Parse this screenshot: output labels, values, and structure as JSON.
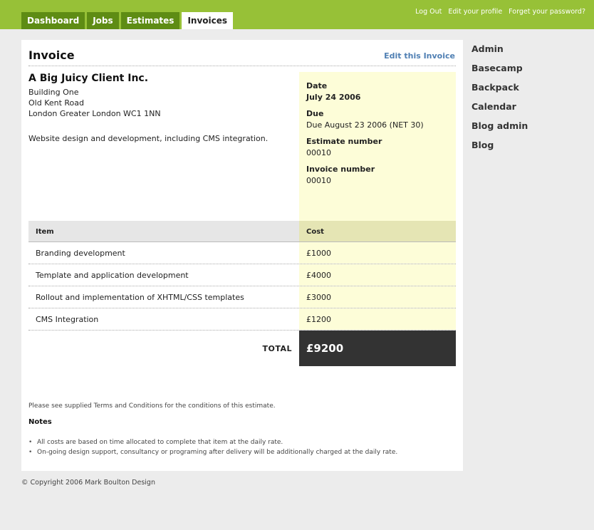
{
  "tabs": [
    {
      "label": "Dashboard",
      "active": false
    },
    {
      "label": "Jobs",
      "active": false
    },
    {
      "label": "Estimates",
      "active": false
    },
    {
      "label": "Invoices",
      "active": true
    }
  ],
  "top_links": [
    "Log Out",
    "Edit your profile",
    "Forget your password?"
  ],
  "invoice": {
    "title": "Invoice",
    "edit_link": "Edit this Invoice",
    "client": {
      "name": "A Big Juicy Client Inc.",
      "address": [
        "Building One",
        "Old Kent Road",
        "London Greater London WC1 1NN"
      ]
    },
    "description": "Website design and development, including CMS integration.",
    "meta": {
      "date_label": "Date",
      "date_value": "July 24 2006",
      "due_label": "Due",
      "due_value": "Due August 23 2006 (NET 30)",
      "estimate_label": "Estimate number",
      "estimate_value": "00010",
      "invoice_label": "Invoice number",
      "invoice_value": "00010"
    },
    "table": {
      "headers": {
        "item": "Item",
        "cost": "Cost"
      },
      "rows": [
        {
          "item": "Branding development",
          "cost": "£1000"
        },
        {
          "item": "Template and application development",
          "cost": "£4000"
        },
        {
          "item": "Rollout and implementation of XHTML/CSS templates",
          "cost": "£3000"
        },
        {
          "item": "CMS Integration",
          "cost": "£1200"
        }
      ],
      "total_label": "TOTAL",
      "total_value": "£9200"
    },
    "terms": "Please see supplied Terms and Conditions for the conditions of this estimate.",
    "notes_heading": "Notes",
    "notes": [
      "All costs are based on time allocated to complete that item at the daily rate.",
      "On-going design support, consultancy or programing after delivery will be additionally charged at the daily rate."
    ]
  },
  "sidenav": [
    "Admin",
    "Basecamp",
    "Backpack",
    "Calendar",
    "Blog admin",
    "Blog"
  ],
  "footer": "© Copyright 2006 Mark Boulton Design",
  "colors": {
    "brand_green": "#97c137",
    "tab_dark_green": "#5e8c14",
    "highlight_yellow": "#fdfdd8",
    "link_blue": "#4f7fb3",
    "total_bg": "#333333"
  }
}
